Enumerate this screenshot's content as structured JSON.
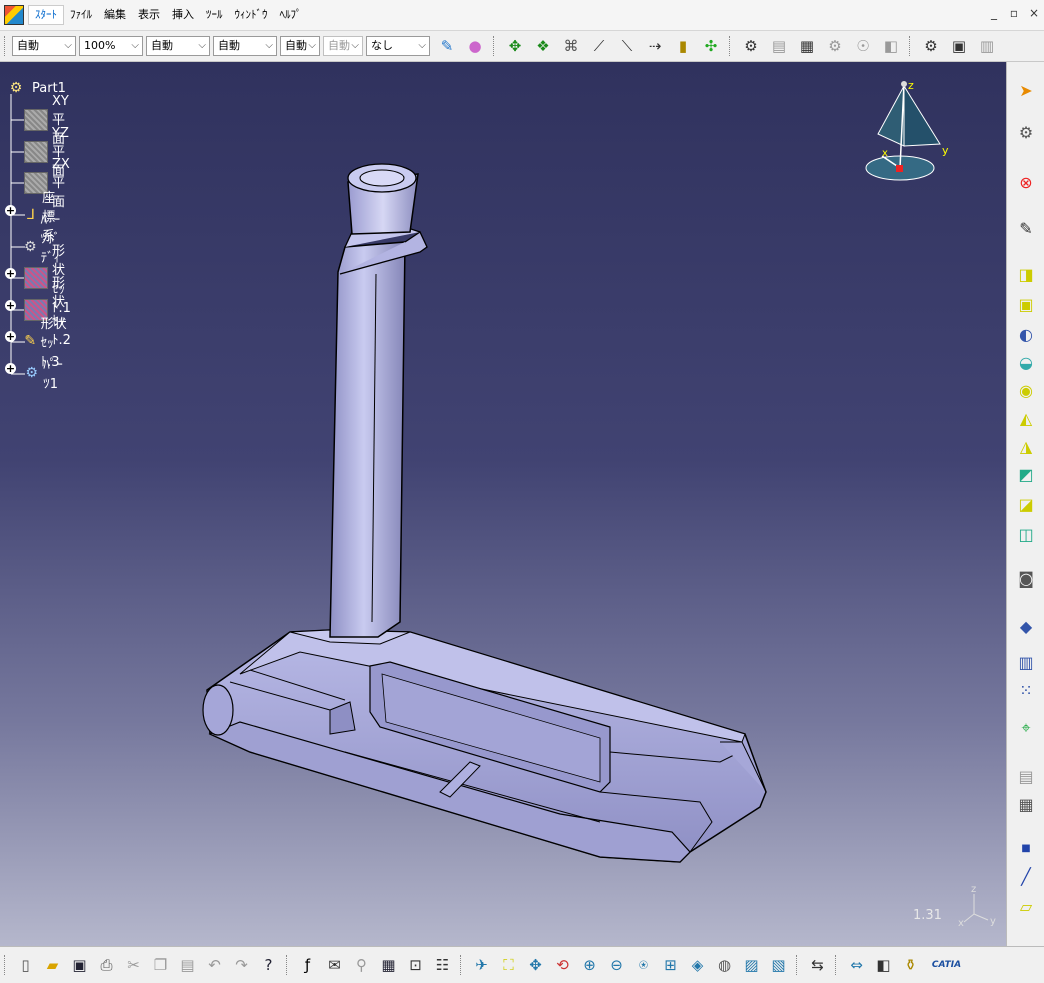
{
  "menubar": {
    "start": "ｽﾀｰﾄ",
    "items": [
      "ﾌｧｲﾙ",
      "編集",
      "表示",
      "挿入",
      "ﾂｰﾙ",
      "ｳｨﾝﾄﾞｳ",
      "ﾍﾙﾌﾟ"
    ],
    "window_controls": [
      "_",
      "▫",
      "×"
    ]
  },
  "toolbar": {
    "combos": [
      {
        "value": "自動",
        "enabled": true
      },
      {
        "value": "100%",
        "enabled": true
      },
      {
        "value": "自動",
        "enabled": true
      },
      {
        "value": "自動",
        "enabled": true
      },
      {
        "value": "自動",
        "enabled": true
      },
      {
        "value": "自動",
        "enabled": false
      },
      {
        "value": "なし",
        "enabled": true
      }
    ],
    "icons": [
      "paintbrush-icon",
      "apply-material-icon",
      "move-compass-icon",
      "snap-icon",
      "manipulate-icon",
      "pick-point-icon",
      "measure-icon",
      "dimension-icon",
      "ruler-icon",
      "reset-compass-icon",
      "update-icon",
      "scan-icon",
      "table-icon",
      "knowledge-icon",
      "check-icon",
      "rule-icon"
    ]
  },
  "tree": {
    "root": "Part1",
    "items": [
      {
        "label": "XY平面",
        "icon": "plane-icon",
        "expandable": false
      },
      {
        "label": "YZ平面",
        "icon": "plane-icon",
        "expandable": false
      },
      {
        "label": "ZX平面",
        "icon": "plane-icon",
        "expandable": false
      },
      {
        "label": "座標系",
        "icon": "axis-system-icon",
        "expandable": true
      },
      {
        "label": "ﾊﾟｰﾂﾎﾞﾃﾞｨｰ",
        "icon": "part-body-icon",
        "expandable": false
      },
      {
        "label": "形状ｾｯﾄ.1",
        "icon": "geometrical-set-icon",
        "expandable": true
      },
      {
        "label": "形状ｾｯﾄ.2",
        "icon": "geometrical-set-icon",
        "expandable": true
      },
      {
        "label": "形状ｾｯﾄ.3",
        "icon": "geometrical-set-icon",
        "expandable": true
      },
      {
        "label": "ﾊﾟｰﾂ1",
        "icon": "parts-icon",
        "expandable": true
      }
    ]
  },
  "viewport": {
    "zoom_level": "1.31",
    "compass_labels": {
      "z": "z",
      "y": "y",
      "x": "x"
    },
    "axis_labels": {
      "z": "z",
      "y": "y",
      "x": "x"
    },
    "model": "putter-head-with-shaft"
  },
  "rightbar": {
    "icons": [
      "select-arrow-icon",
      "sketch-gear-icon",
      "stop-icon",
      "sketch-icon",
      "pad-icon",
      "pocket-icon",
      "shaft-icon",
      "groove-icon",
      "hole-icon",
      "rib-icon",
      "slot-icon",
      "stiffener-icon",
      "loft-icon",
      "remove-loft-icon",
      "fillet-icon",
      "chamfer-icon",
      "pattern-icon",
      "scaling-icon",
      "boolean-icon",
      "annotation-icon",
      "point-icon",
      "line-icon",
      "plane-icon"
    ]
  },
  "bottombar": {
    "icons": [
      "new-file-icon",
      "open-folder-icon",
      "save-icon",
      "print-icon",
      "cut-icon",
      "copy-icon",
      "paste-icon",
      "undo-icon",
      "redo-icon",
      "whats-this-icon",
      "formula-icon",
      "comment-icon",
      "measure-icon",
      "table-icon",
      "lock-icon",
      "hierarchy-icon",
      "fly-mode-icon",
      "fit-all-icon",
      "pan-icon",
      "rotate-icon",
      "zoom-in-icon",
      "zoom-out-icon",
      "normal-view-icon",
      "multi-view-icon",
      "iso-view-icon",
      "shading-icon",
      "hide-show-icon",
      "swap-visible-icon",
      "measure-between-icon",
      "measure-item-icon",
      "inertia-icon",
      "catia-logo-icon"
    ],
    "brand": "CATIA"
  },
  "colors": {
    "viewport_top": "#30325e",
    "viewport_bottom": "#b5b7cc",
    "model_fill": "#a8a9d8",
    "model_edge": "#000000"
  }
}
